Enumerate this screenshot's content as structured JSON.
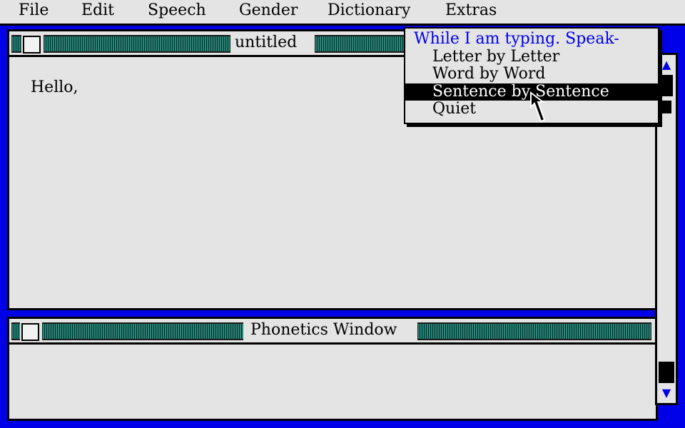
{
  "menubar": {
    "items": [
      {
        "label": "File"
      },
      {
        "label": "Edit"
      },
      {
        "label": "Speech"
      },
      {
        "label": "Gender"
      },
      {
        "label": "Dictionary"
      },
      {
        "label": "Extras"
      }
    ]
  },
  "main_window": {
    "title": "untitled",
    "text": "Hello,"
  },
  "phonetics_window": {
    "title": "Phonetics Window",
    "text": ""
  },
  "dropdown": {
    "header": "While I am typing. Speak-",
    "items": [
      {
        "label": "Letter by Letter",
        "selected": false
      },
      {
        "label": "Word by Word",
        "selected": false
      },
      {
        "label": "Sentence by Sentence",
        "selected": true
      },
      {
        "label": "Quiet",
        "selected": false
      }
    ]
  },
  "colors": {
    "desktop": "#0000e8",
    "window_bg": "#e4e4e4",
    "title_stripes": "#1c8a7c",
    "menu_header": "#0000e8"
  },
  "icons": {
    "scroll_up": "up-arrow-icon",
    "scroll_down": "down-arrow-icon",
    "cursor": "arrow-pointer-icon"
  }
}
